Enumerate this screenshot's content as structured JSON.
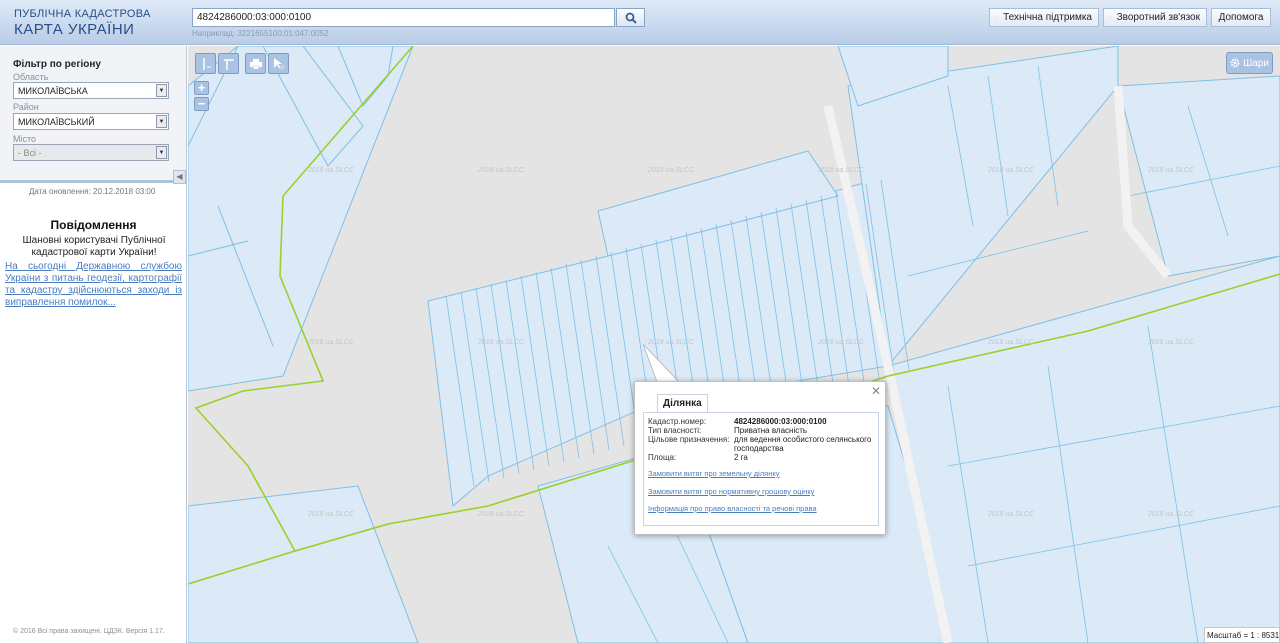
{
  "header": {
    "logo_line1": "ПУБЛІЧНА КАДАСТРОВА",
    "logo_line2": "КАРТА УКРАЇНИ",
    "search_value": "4824286000:03:000:0100",
    "search_hint": "Наприклад: 3221655100:01:047:0052",
    "btn_support": "Технічна підтримка",
    "btn_feedback": "Зворотний зв'язок",
    "btn_help": "Допомога"
  },
  "sidebar": {
    "filter_title": "Фільтр по регіону",
    "oblast_label": "Область",
    "oblast_value": "МИКОЛАЇВСЬКА",
    "rayon_label": "Район",
    "rayon_value": "МИКОЛАЇВСЬКИЙ",
    "city_label": "Місто",
    "city_value": "- Всі -",
    "update_date": "Дата оновлення: 20.12.2018 03:00",
    "notice_title": "Повідомлення",
    "notice_greeting": "Шановні користувачі Публічної кадастрової карти України!",
    "notice_link": "На сьогодні Державною службою України з питань геодезії, картографії та кадастру здійснюються заходи із виправлення помилок...",
    "copyright": "© 2016 Всі права захищені. ЦДЗК. Версія 1.17."
  },
  "map": {
    "layers_label": "Шари",
    "scale_label": "Масштаб = 1 : 8531",
    "watermark": "2018 ua.SLCC",
    "colors": {
      "parcel_stroke": "#7fbfe6",
      "parcel_fill": "#dbeaf6",
      "road_stroke": "#9ccf2b",
      "map_bg": "#e4e4e4"
    }
  },
  "popup": {
    "tab": "Ділянка",
    "fields": [
      {
        "key": "Кадастр.номер:",
        "value": "4824286000:03:000:0100"
      },
      {
        "key": "Тип власності:",
        "value": "Приватна власність"
      },
      {
        "key": "Цільове призначення:",
        "value": "для ведення особистого селянського господарства"
      },
      {
        "key": "Площа:",
        "value": "2 га"
      }
    ],
    "link1": "Замовити витяг про земельну ділянку",
    "link2": "Замовити витяг про нормативну грошову оцінку",
    "link3": "Інформація про право власності та речові права"
  }
}
